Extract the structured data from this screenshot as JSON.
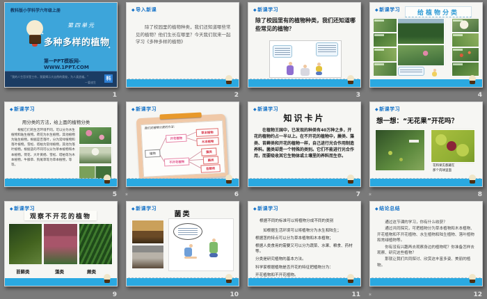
{
  "icons": {
    "diamond": "◆",
    "sparkle": "✦",
    "transition": "✶"
  },
  "colors": {
    "canvas_bg": "#7a7a7a",
    "slide_bg": "#f6f6f3",
    "strip_blue": "#2aa9e1",
    "header_blue": "#1673c8",
    "title_slide_blue": "#3da5da",
    "navy_bar": "#1b3c63"
  },
  "slides": [
    {
      "number": "1",
      "course": "教科版小学科学六年级上册",
      "unit": "第四单元",
      "title": "多种多样的植物",
      "site": "第一PPT模板网-WWW.1PPT.COM",
      "quote": "“我的人生哲学是工作，我要揭示大自然的奥秘，为人类造福。”",
      "author": "—爱迪生",
      "seal": "科"
    },
    {
      "number": "2",
      "header": "导入新课",
      "body": "除了校园里的植物种类，我们还知道哪些常见的植物？他们生长在哪里？今天我们就来一起学习《多种多样的植物》"
    },
    {
      "number": "3",
      "header": "新课学习",
      "question": "除了校园里有的植物种类，我们还知道哪些常见的植物？"
    },
    {
      "number": "4",
      "header": "新课学习",
      "title": "给植物分类"
    },
    {
      "number": "5",
      "header": "新课学习",
      "subtitle": "用分类的方法，给上面的植物分类",
      "body": "根据它们的生活环境不同，可以分为水生植物和陆生植物。荷花为水生植物，其他植物为陆生植物。根据是否落叶，分为常绿植物和落叶植物。雪松、塔柏为常绿植物，其他为落叶植物。根据茎的不同可以分为草本植物和木本植物。荷花、大叶黄杨、雪松、塔柏等为木本植物，牛膝草、狗尾草等为草本植物，等等。"
    },
    {
      "number": "6",
      "header": "新课学习",
      "note": "我们对植物分类的方法：",
      "root": "植物",
      "flowering": "开花植物",
      "nonflowering": "不开花植物",
      "herb": "草本植物",
      "woody": "木本植物",
      "algae": "藻类",
      "fern": "蕨类",
      "moss": "苔藓类"
    },
    {
      "number": "7",
      "header": "新课学习",
      "title": "知识卡片",
      "body": "在植物王国中，已发现的种类有40万种之多，开花的植物约占一半以上。在不开花的植物中，蕨类、藻类、苔藓类和开花的植物一样，自己进行光合作用制造养料。菌类却是一个特殊的类别。它们不能进行光合作用，而要吸收其它生物体或土壤里的养料而生存。"
    },
    {
      "number": "8",
      "header": "新课学习",
      "title": "想一想：“无花果”开花吗？",
      "caption_line1": "花和果实都藏在",
      "caption_line2": "那个肉球里面"
    },
    {
      "number": "9",
      "header": "新课学习",
      "title": "观察不开花的植物",
      "labels": [
        "苔藓类",
        "藻类",
        "蕨类"
      ]
    },
    {
      "number": "10",
      "header": "新课学习",
      "title": "菌类"
    },
    {
      "number": "11",
      "header": "新课学习",
      "lead": "根据不同的标准可以将植物分成不同的类别",
      "lines": [
        "如根据生活环境可以将植物分为水生和陆生；",
        "根据茎的特点可以分为草本植物和木本植物；",
        "根据人类食用的需要又可以分为蔬菜、水果、粮食、药材等。",
        "分类是研究植物的基本方法。",
        "科学家根据植物是否开花的特征把植物分为：",
        "开花植物和不开花植物。"
      ]
    },
    {
      "number": "12",
      "header": "结论总结",
      "lines": [
        "通过这节课的学习，你有什么收获？",
        "通过共同探究，可把植物分为草本植物和木本植物、开花植物和不开花植物、水生植物和陆生植物、落叶植物和常绿植物等。",
        "你有没有兴趣再去观察身边的植物呢？你准备怎样去观察、研究这些植物？",
        "那就让我们共同探讨、欣赏这丰富多姿、美丽的植物。"
      ]
    }
  ]
}
